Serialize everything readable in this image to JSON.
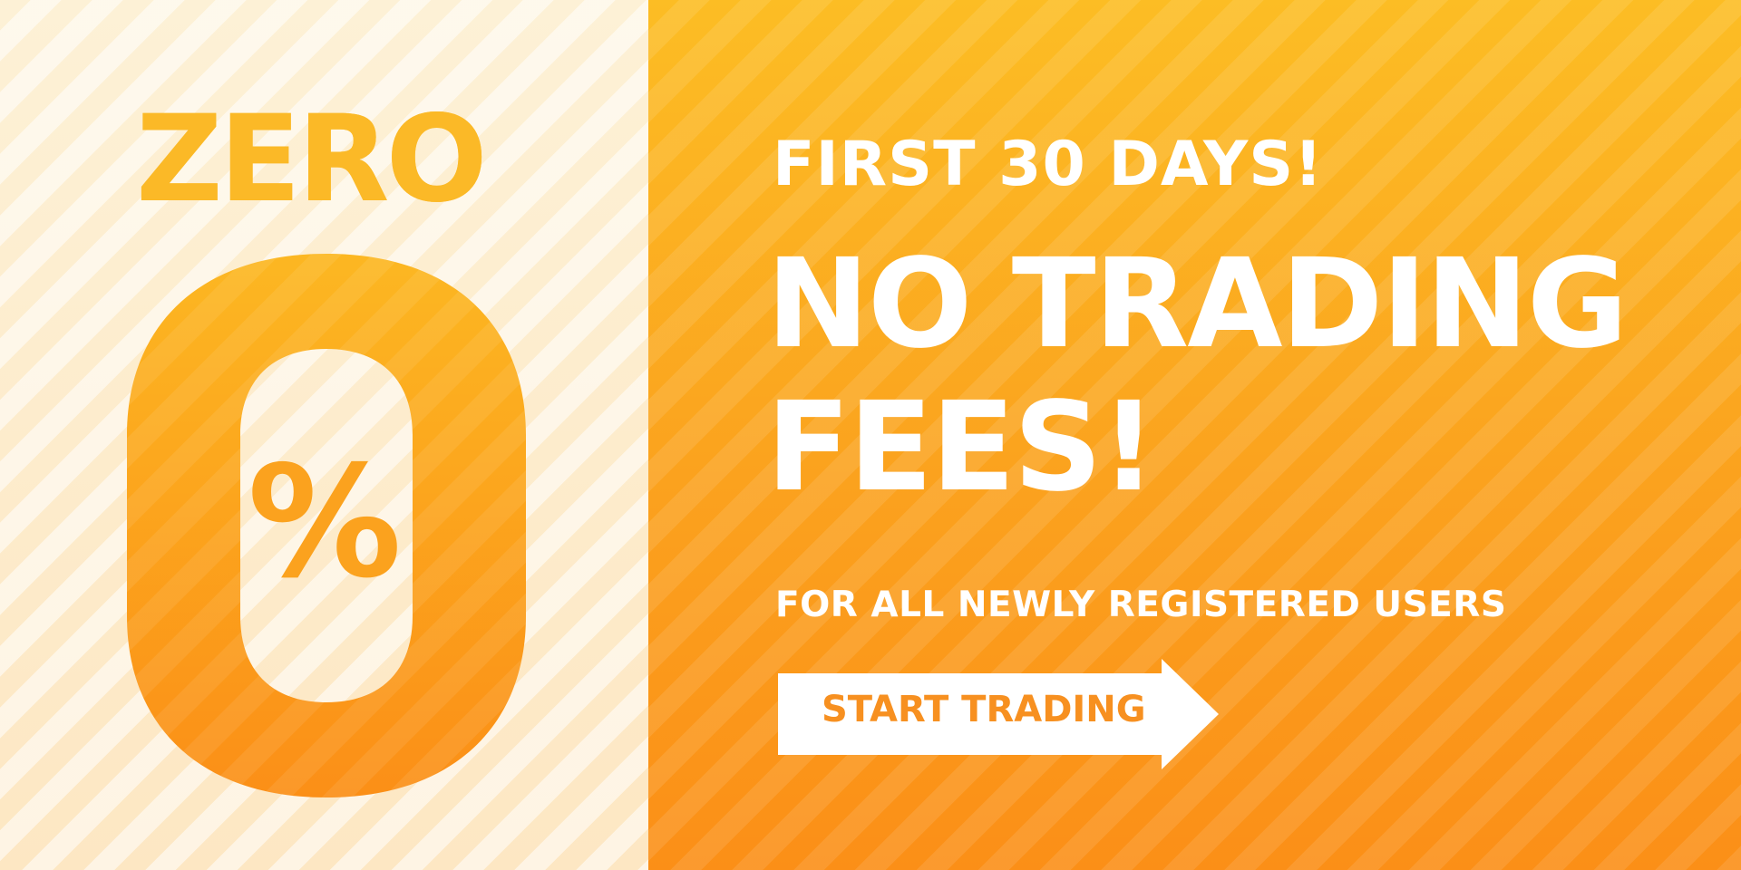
{
  "promo": {
    "badge_word": "ZERO",
    "badge_symbol": "%",
    "subtitle": "FIRST 30 DAYS!",
    "headline_line1": "NO TRADING",
    "headline_line2": "FEES!",
    "tagline": "FOR ALL NEWLY REGISTERED USERS",
    "cta_label": "START TRADING"
  },
  "colors": {
    "orange_top": "#fcbd24",
    "orange_bottom": "#fb8f17",
    "cream": "#fdf1d6",
    "white": "#ffffff",
    "cta_text": "#f79020"
  },
  "icons": {
    "cta_arrow": "arrow-right-icon",
    "zero_badge": "zero-percent-icon"
  }
}
